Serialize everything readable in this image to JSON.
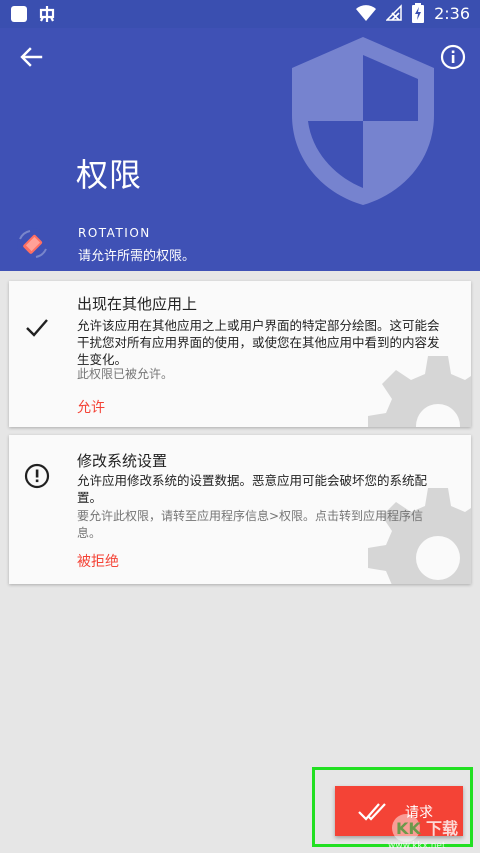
{
  "status_bar": {
    "time": "2:36",
    "left_icons": [
      "square-notification-icon",
      "app-notification-icon"
    ],
    "right_icons": [
      "wifi-icon",
      "no-signal-icon",
      "battery-charging-icon"
    ]
  },
  "header": {
    "title": "权限",
    "app_name": "ROTATION",
    "subtitle": "请允许所需的权限。",
    "background_color": "#3f51b5",
    "icons": [
      "back-arrow-icon",
      "info-icon",
      "shield-icon",
      "rotation-app-icon"
    ]
  },
  "permissions": [
    {
      "title": "出现在其他应用上",
      "description_lines": [
        "允许该应用在其他应用之上或用户界面的特定部分绘图。这可能会",
        "干扰您对所有应用界面的使用，或使您在其他应用中看到的内容发",
        "生变化。"
      ],
      "note_lines": [
        "此权限已被允许。"
      ],
      "action": "允许",
      "status_icon": "check-icon"
    },
    {
      "title": "修改系统设置",
      "description_lines": [
        "允许应用修改系统的设置数据。恶意应用可能会破坏您的系统配",
        "置。"
      ],
      "note_lines": [
        "要允许此权限，请转至应用程序信息>权限。点击转到应用程序信",
        "息。"
      ],
      "action": "被拒绝",
      "status_icon": "alert-circle-icon"
    }
  ],
  "fab": {
    "label": "请求",
    "icon": "double-check-icon",
    "color": "#f44336",
    "highlight_color": "#22e022"
  },
  "watermark": {
    "text": "www.kkx.net",
    "logo_text": "KK下载"
  }
}
